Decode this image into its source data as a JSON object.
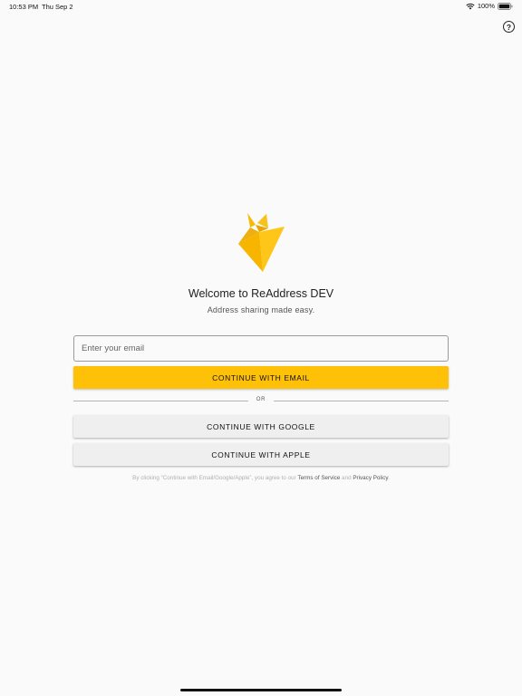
{
  "status_bar": {
    "time": "10:53 PM",
    "date": "Thu Sep 2",
    "battery": "100%"
  },
  "help": {
    "label": "?"
  },
  "brand": {
    "accent_color": "#ffc107",
    "logo_icon": "paper-flame-logo"
  },
  "welcome": {
    "title": "Welcome to ReAddress DEV",
    "subtitle": "Address sharing made easy."
  },
  "email": {
    "value": "",
    "placeholder": "Enter your email"
  },
  "buttons": {
    "continue_email": "CONTINUE WITH EMAIL",
    "divider_text": "OR",
    "continue_google": "CONTINUE WITH GOOGLE",
    "continue_apple": "CONTINUE WITH APPLE"
  },
  "legal": {
    "prefix": "By clicking “Continue with Email/Google/Apple”, you agree to our ",
    "terms": "Terms of Service",
    "and": " and ",
    "privacy": "Privacy Policy",
    "suffix": "."
  }
}
